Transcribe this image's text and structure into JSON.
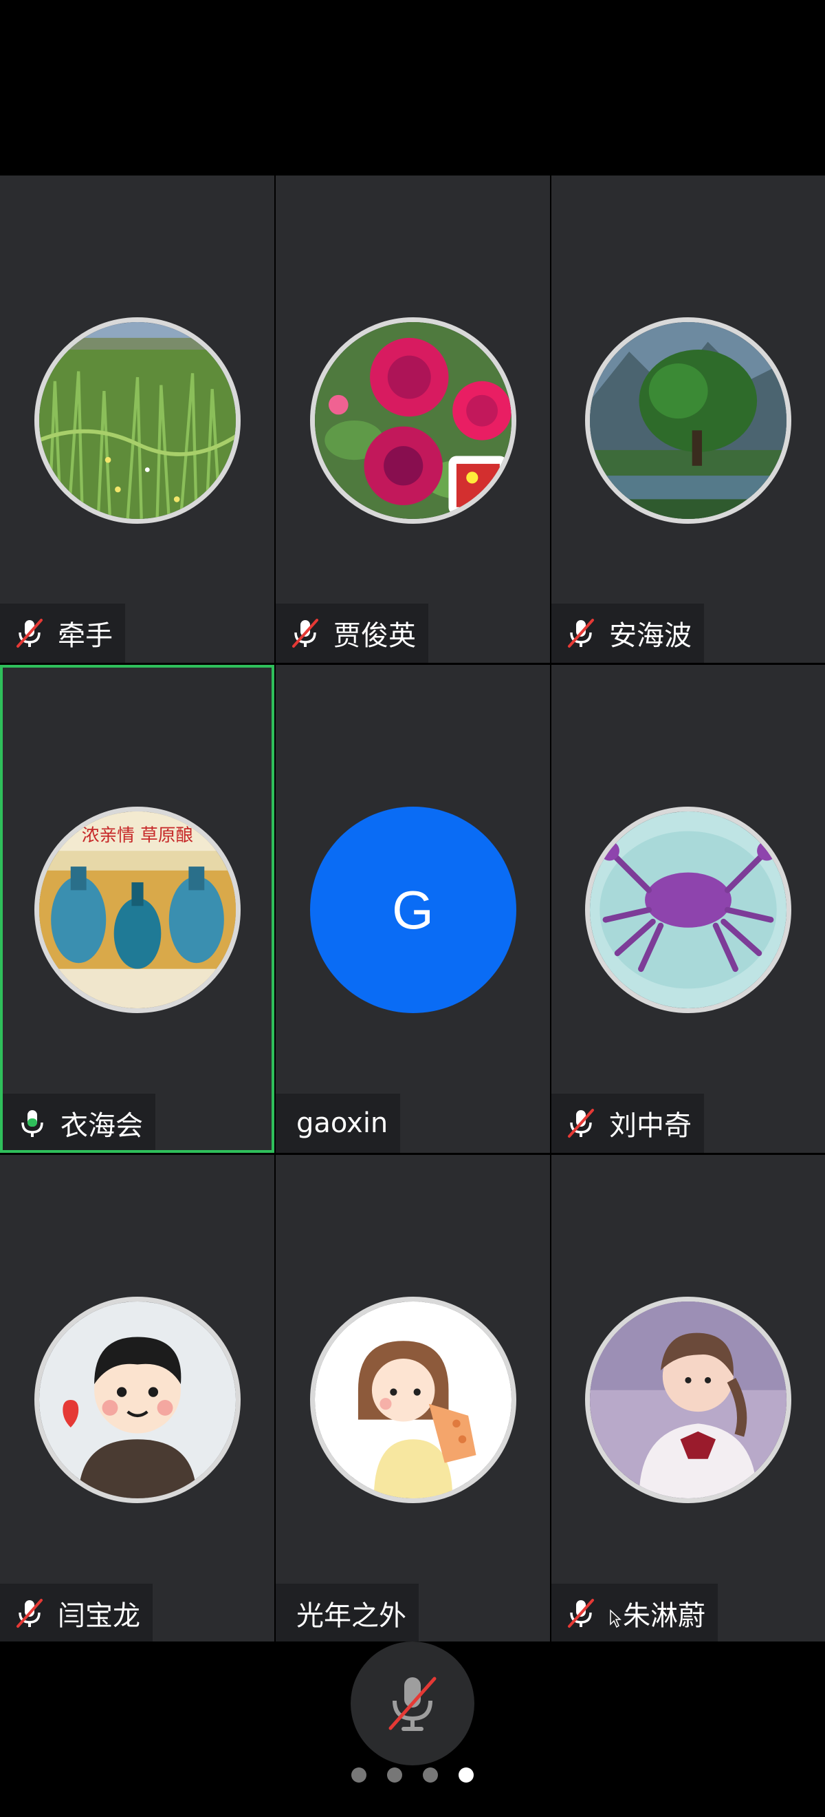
{
  "participants": [
    {
      "name": "牵手",
      "mic": "muted",
      "avatar": "grassland-photo"
    },
    {
      "name": "贾俊英",
      "mic": "muted",
      "avatar": "peony-flowers-photo"
    },
    {
      "name": "安海波",
      "mic": "muted",
      "avatar": "tree-landscape-photo"
    },
    {
      "name": "衣海会",
      "mic": "active",
      "avatar": "liquor-bottles-photo",
      "avatar_text": "浓亲情 草原酿"
    },
    {
      "name": "gaoxin",
      "mic": "none",
      "avatar_letter": "G",
      "avatar_color": "#0a6cf5"
    },
    {
      "name": "刘中奇",
      "mic": "muted",
      "avatar": "purple-crab-photo"
    },
    {
      "name": "闫宝龙",
      "mic": "muted",
      "avatar": "cartoon-boy"
    },
    {
      "name": "光年之外",
      "mic": "none",
      "avatar": "cartoon-girl-eating"
    },
    {
      "name": "朱淋蔚",
      "mic": "muted",
      "avatar": "girl-photo"
    }
  ],
  "controls": {
    "mic_button": "microphone-muted-icon"
  },
  "pagination": {
    "total": 4,
    "current": 4
  },
  "colors": {
    "tile_bg": "#2b2c2f",
    "active_border": "#2fbf5b",
    "muted_red": "#e53935",
    "avatar_blue": "#0a6cf5"
  }
}
